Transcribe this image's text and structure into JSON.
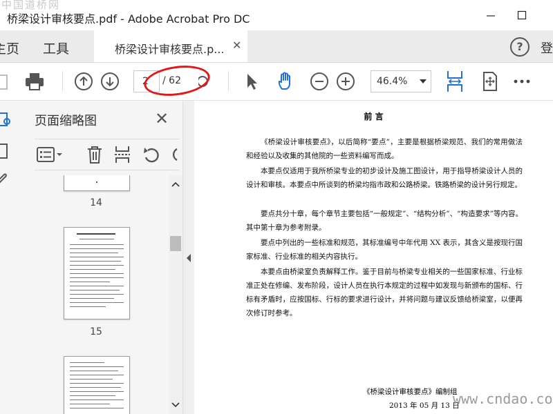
{
  "watermark_top": "中国道桥网",
  "watermark_bottom": "www.cndao.com",
  "window": {
    "title": "桥梁设计审核要点.pdf - Adobe Acrobat Pro DC"
  },
  "tabs": {
    "home": "主页",
    "tools": "工具",
    "doc": "桥梁设计审核要点.p...",
    "login": "登"
  },
  "toolbar": {
    "page_current": "2",
    "page_total": "/ 62",
    "zoom": "46.4%"
  },
  "panel": {
    "title": "页面缩略图",
    "thumb_numbers": [
      "14",
      "15"
    ]
  },
  "document": {
    "heading": "前 言",
    "paragraphs": [
      "《桥梁设计审核要点》，以后简称“要点”，主要是根据桥梁规范、我们的常用做法和经验以及收集的其他院的一些资料编写而成。",
      "本要点仅适用于我所桥梁专业的初步设计及施工图设计，用于指导桥梁设计人员的设计和审核。本要点中所谈到的桥梁均指市政和公路桥梁。铁路桥梁的设计另行规定。",
      "要点共分十章，每个章节主要包括“一般规定”、“结构分析”、“构造要求”等内容。其中第十章为参考附录。",
      "要点中列出的一些标准和规范，其标准编号中年代用 XX 表示，其含义是按现行国家标准、行业标准的相关内容执行。",
      "本要点由桥梁室负责解释工作。鉴于目前与桥梁专业相关的一些国家标准、行业标准正处在修编、发布阶段，设计人员在执行本规定的过程中如发现与新颁布的国标、行标有矛盾时，应按国标、行标的要求进行设计，并将问题与建议反馈给桥梁室，以便再次修订时参考。"
    ],
    "signature": "《桥梁设计审核要点》编制组",
    "date": "2013 年 05 月 13 日"
  },
  "colors": {
    "accent_blue": "#1f6fd6",
    "annotation_red": "#e01818",
    "window_border": "#e6d200"
  }
}
